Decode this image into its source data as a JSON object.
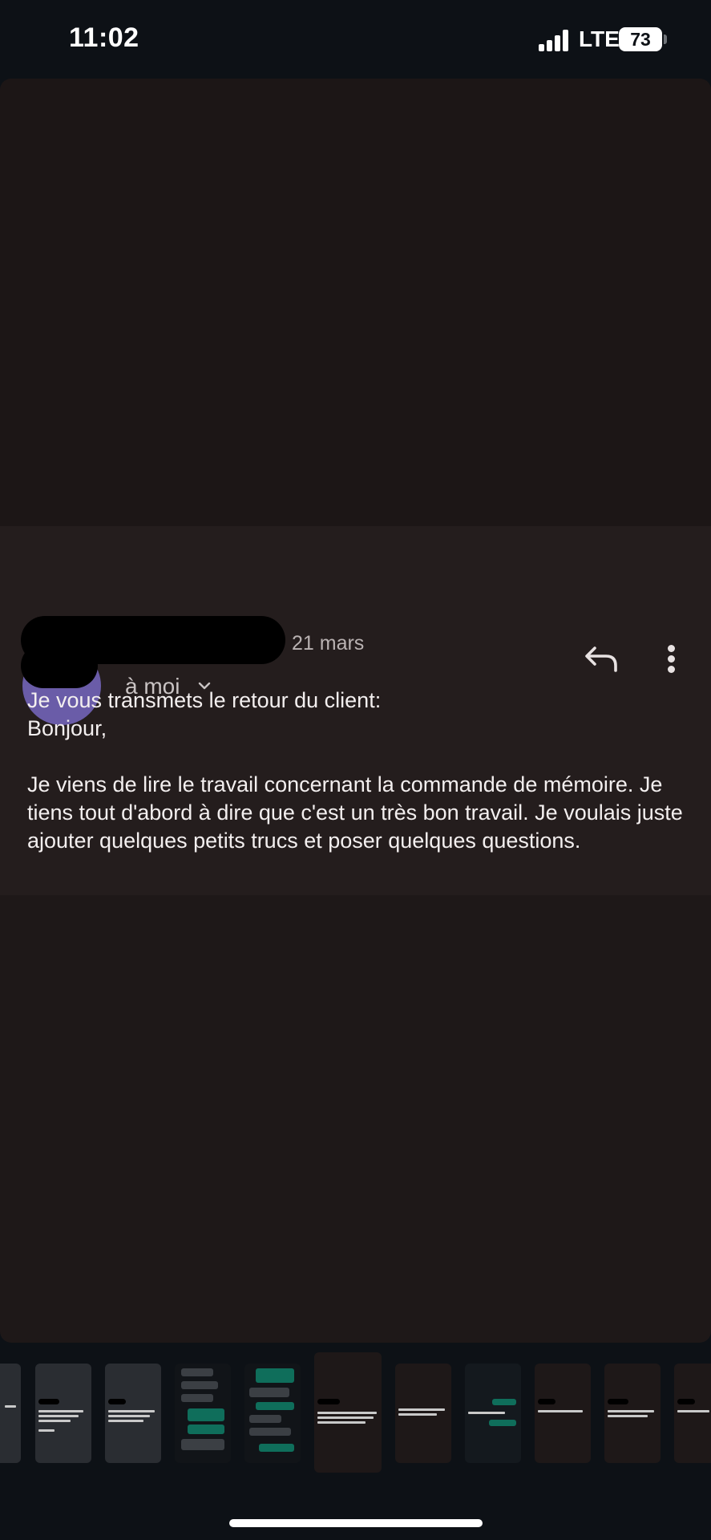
{
  "status_bar": {
    "time": "11:02",
    "network": "LTE",
    "battery": "73"
  },
  "email": {
    "date": "21 mars",
    "recipient": "à moi",
    "body": "Je vous transmets le retour du client:\nBonjour,\n\nJe viens de lire le travail concernant la commande de mémoire. Je tiens tout d'abord à dire que c'est un très bon travail. Je voulais juste ajouter quelques petits trucs et poser quelques questions."
  },
  "icons": {
    "reply": "reply-icon",
    "more": "more-vertical-icon",
    "chevron": "chevron-down-icon",
    "signal": "cellular-signal-icon",
    "battery": "battery-icon"
  },
  "colors": {
    "background": "#0d1116",
    "card": "#1e1818",
    "message_panel": "#241d1d",
    "text": "#f3efef",
    "accent_green": "#0f6e5b"
  }
}
